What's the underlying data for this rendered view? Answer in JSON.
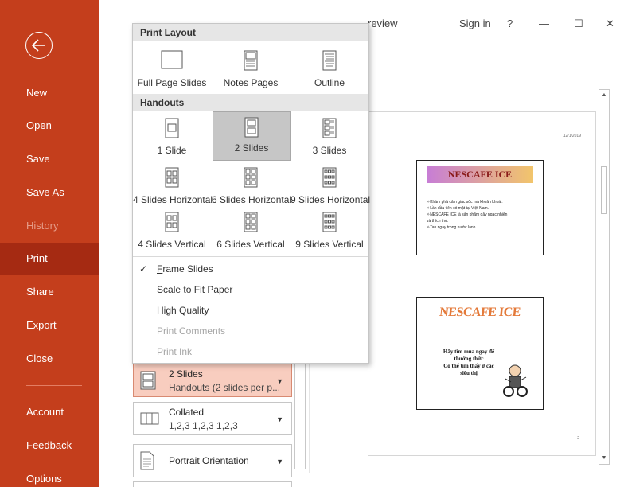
{
  "sidebar": {
    "items": [
      {
        "label": "New",
        "state": "normal"
      },
      {
        "label": "Open",
        "state": "normal"
      },
      {
        "label": "Save",
        "state": "normal"
      },
      {
        "label": "Save As",
        "state": "normal"
      },
      {
        "label": "History",
        "state": "disabled"
      },
      {
        "label": "Print",
        "state": "active"
      },
      {
        "label": "Share",
        "state": "normal"
      },
      {
        "label": "Export",
        "state": "normal"
      },
      {
        "label": "Close",
        "state": "normal"
      },
      {
        "label": "Account",
        "state": "normal"
      },
      {
        "label": "Feedback",
        "state": "normal"
      },
      {
        "label": "Options",
        "state": "normal"
      }
    ],
    "colors": {
      "background": "#c43e1c",
      "active": "#a52a12"
    }
  },
  "titlebar": {
    "doc_title_fragment": "POWER POINT - PowerPoint Preview",
    "visible_title_end": "review",
    "sign_in": "Sign in",
    "help": "?",
    "minimize": "—",
    "maximize": "☐",
    "close": "✕"
  },
  "dropdown": {
    "print_layout_header": "Print Layout",
    "layouts": [
      "Full Page Slides",
      "Notes Pages",
      "Outline"
    ],
    "handouts_header": "Handouts",
    "handouts_row1": [
      "1 Slide",
      "2 Slides",
      "3 Slides"
    ],
    "handouts_row2": [
      "4 Slides Horizontal",
      "6 Slides Horizontal",
      "9 Slides Horizontal"
    ],
    "handouts_row3": [
      "4 Slides Vertical",
      "6 Slides Vertical",
      "9 Slides Vertical"
    ],
    "selected": "2 Slides",
    "options": {
      "frame_slides": {
        "first": "F",
        "rest": "rame Slides",
        "checked": true
      },
      "scale_to_fit": {
        "first": "S",
        "rest": "cale to Fit Paper"
      },
      "high_quality": "High Quality",
      "print_comments": "Print Comments",
      "print_ink": "Print Ink"
    }
  },
  "settings": {
    "handouts": {
      "line1": "2 Slides",
      "line2": "Handouts (2 slides per p..."
    },
    "collated": {
      "line1": "Collated",
      "line2": "1,2,3   1,2,3   1,2,3"
    },
    "orientation": {
      "label": "Portrait Orientation"
    }
  },
  "preview": {
    "date": "12/1/2019",
    "page_number": "2",
    "slide1": {
      "title": "NESCAFE ICE",
      "bullets": [
        "✧Khám phá cảm giác sôc mà khoản khoái.",
        "✧Lần đầu tiên có mặt tại Việt Nam.",
        "✧NESCAFE ICE là sản phẩm gây ngạc nhiên",
        "   và thích thú.",
        "✧Tan ngay trong nước lạnh."
      ]
    },
    "slide2": {
      "wordart": "NESCAFE ICE",
      "text_lines": [
        "Hãy tìm mua ngay để",
        "thưởng thức",
        "Có thể tìm thấy ở các",
        "siêu thị"
      ]
    }
  }
}
